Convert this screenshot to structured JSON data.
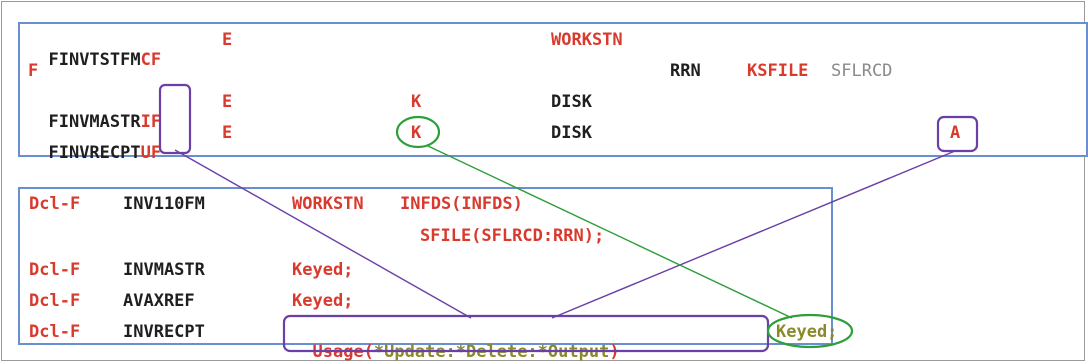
{
  "fixed_form": {
    "line1": {
      "file": "FINVTSTFM",
      "type": "CF",
      "designation": "E",
      "device": "WORKSTN"
    },
    "line2": {
      "file": "F",
      "field": "RRN",
      "keyword": "KSFILE",
      "record": "SFLRCD"
    },
    "line3": {
      "file": "FINVMASTR",
      "type": "IF",
      "designation": "E",
      "key": "K",
      "device": "DISK"
    },
    "line4": {
      "file": "FINVRECPT",
      "type": "UF",
      "designation": "E",
      "key": "K",
      "device": "DISK",
      "add": "A"
    }
  },
  "free_form": {
    "line1": {
      "kw": "Dcl-F",
      "name": "INV110FM",
      "device": "WORKSTN",
      "infds": "INFDS(INFDS)"
    },
    "line2": {
      "sfile": "SFILE(SFLRCD:RRN);"
    },
    "line3": {
      "kw": "Dcl-F",
      "name": "INVMASTR",
      "keyed": "Keyed;"
    },
    "line4": {
      "kw": "Dcl-F",
      "name": "AVAXREF",
      "keyed": "Keyed;"
    },
    "line5": {
      "kw": "Dcl-F",
      "name": "INVRECPT",
      "usage_open": "Usage(",
      "usage_value": "*Update:*Delete:*Output",
      "usage_close": ")",
      "keyed": "Keyed;"
    }
  },
  "colors": {
    "keyword": "#d93a2e",
    "text": "#1f1f1f",
    "literal": "#8a8a2a",
    "box_border": "#6a8fd0",
    "purple_mark": "#6a3fa8",
    "green_mark": "#2e9e3a"
  }
}
